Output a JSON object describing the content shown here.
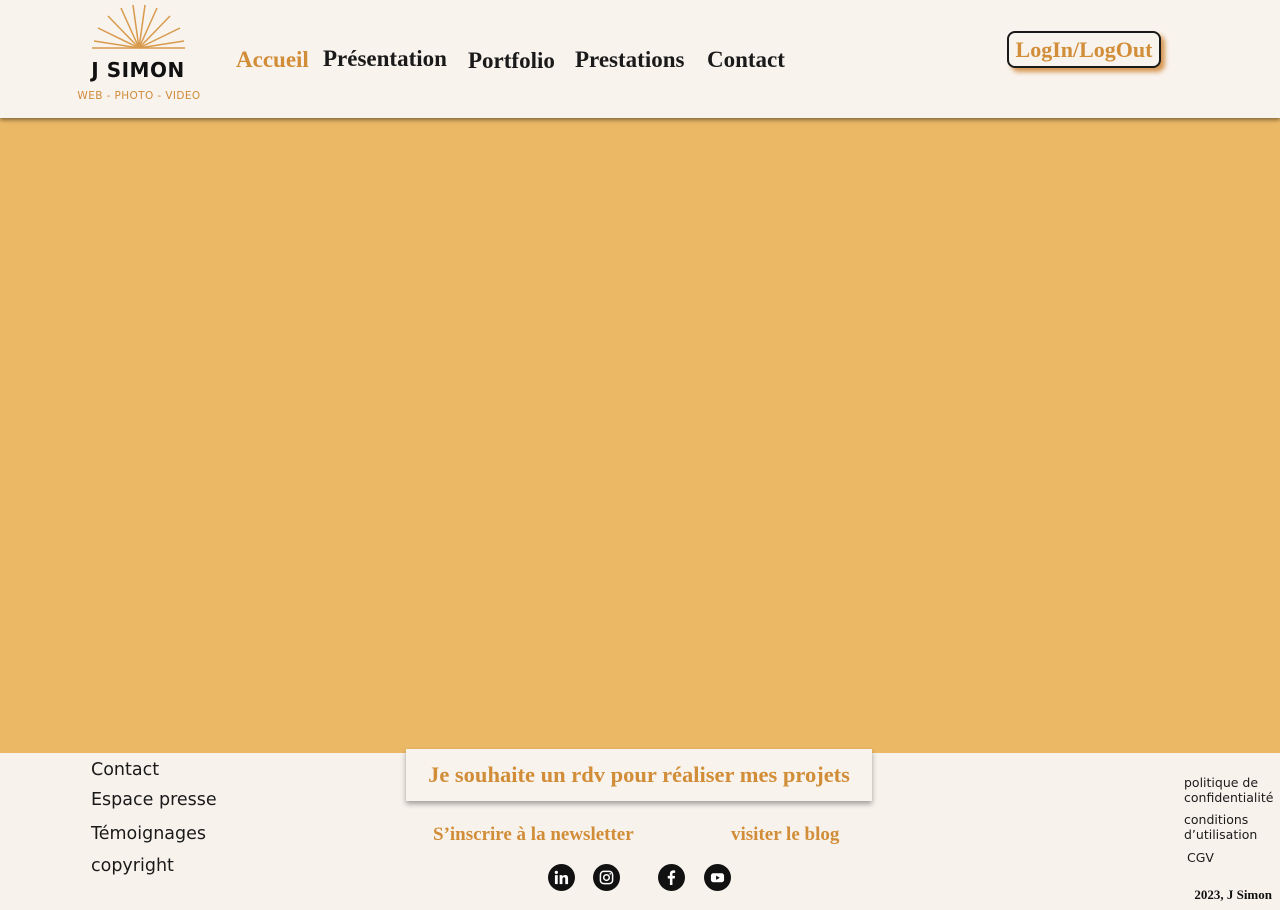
{
  "brand": {
    "name": "J SIMON",
    "tagline": "WEB - PHOTO - VIDEO",
    "accent_color": "#d18d37",
    "hero_color": "#ebb866"
  },
  "nav": {
    "items": [
      {
        "label": "Accueil",
        "active": true
      },
      {
        "label": "Présentation",
        "active": false
      },
      {
        "label": "Portfolio",
        "active": false
      },
      {
        "label": "Prestations",
        "active": false
      },
      {
        "label": "Contact",
        "active": false
      }
    ],
    "login_label": "LogIn/LogOut"
  },
  "footer": {
    "links": [
      "Contact",
      "Espace presse",
      "Témoignages",
      "copyright"
    ],
    "cta_label": "Je souhaite un rdv pour réaliser mes projets",
    "newsletter_label": "S’inscrire à la newsletter",
    "blog_label": "visiter le blog",
    "social": [
      "linkedin-icon",
      "instagram-icon",
      "facebook-icon",
      "youtube-icon"
    ],
    "legal": {
      "privacy": "politique de confidentialité",
      "terms": "conditions d’utilisation",
      "cgv": "CGV"
    },
    "copyright_text": "2023, J Simon"
  }
}
